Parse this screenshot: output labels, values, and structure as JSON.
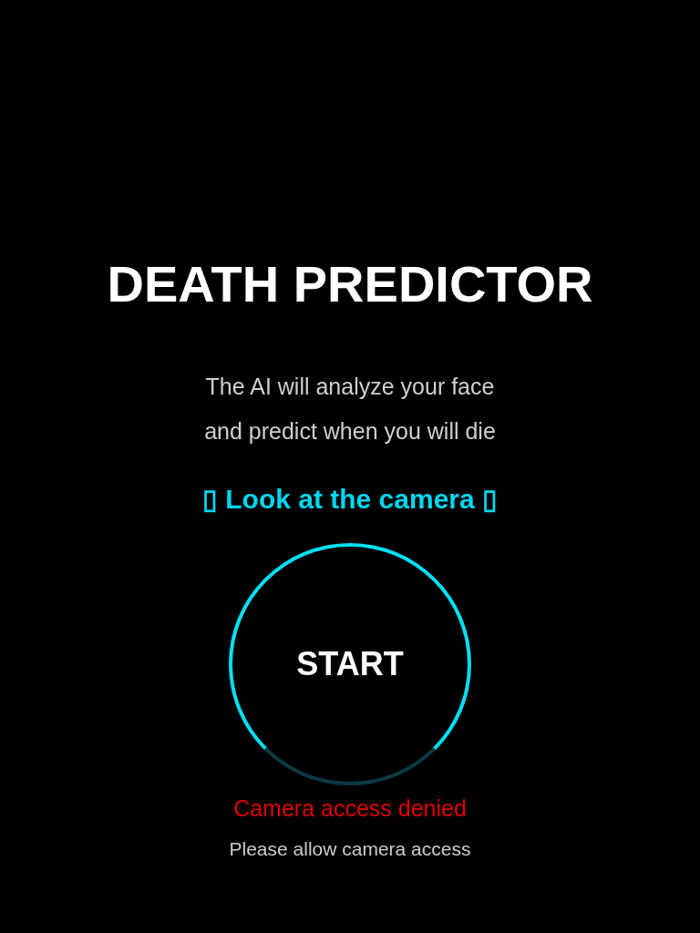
{
  "title": "DEATH PREDICTOR",
  "subtitle_lines": [
    "The AI will analyze your face",
    "and predict when you will die"
  ],
  "hint": "▯ Look at the camera ▯",
  "start_button": "START",
  "error": "Camera access denied",
  "note": "Please allow camera access"
}
